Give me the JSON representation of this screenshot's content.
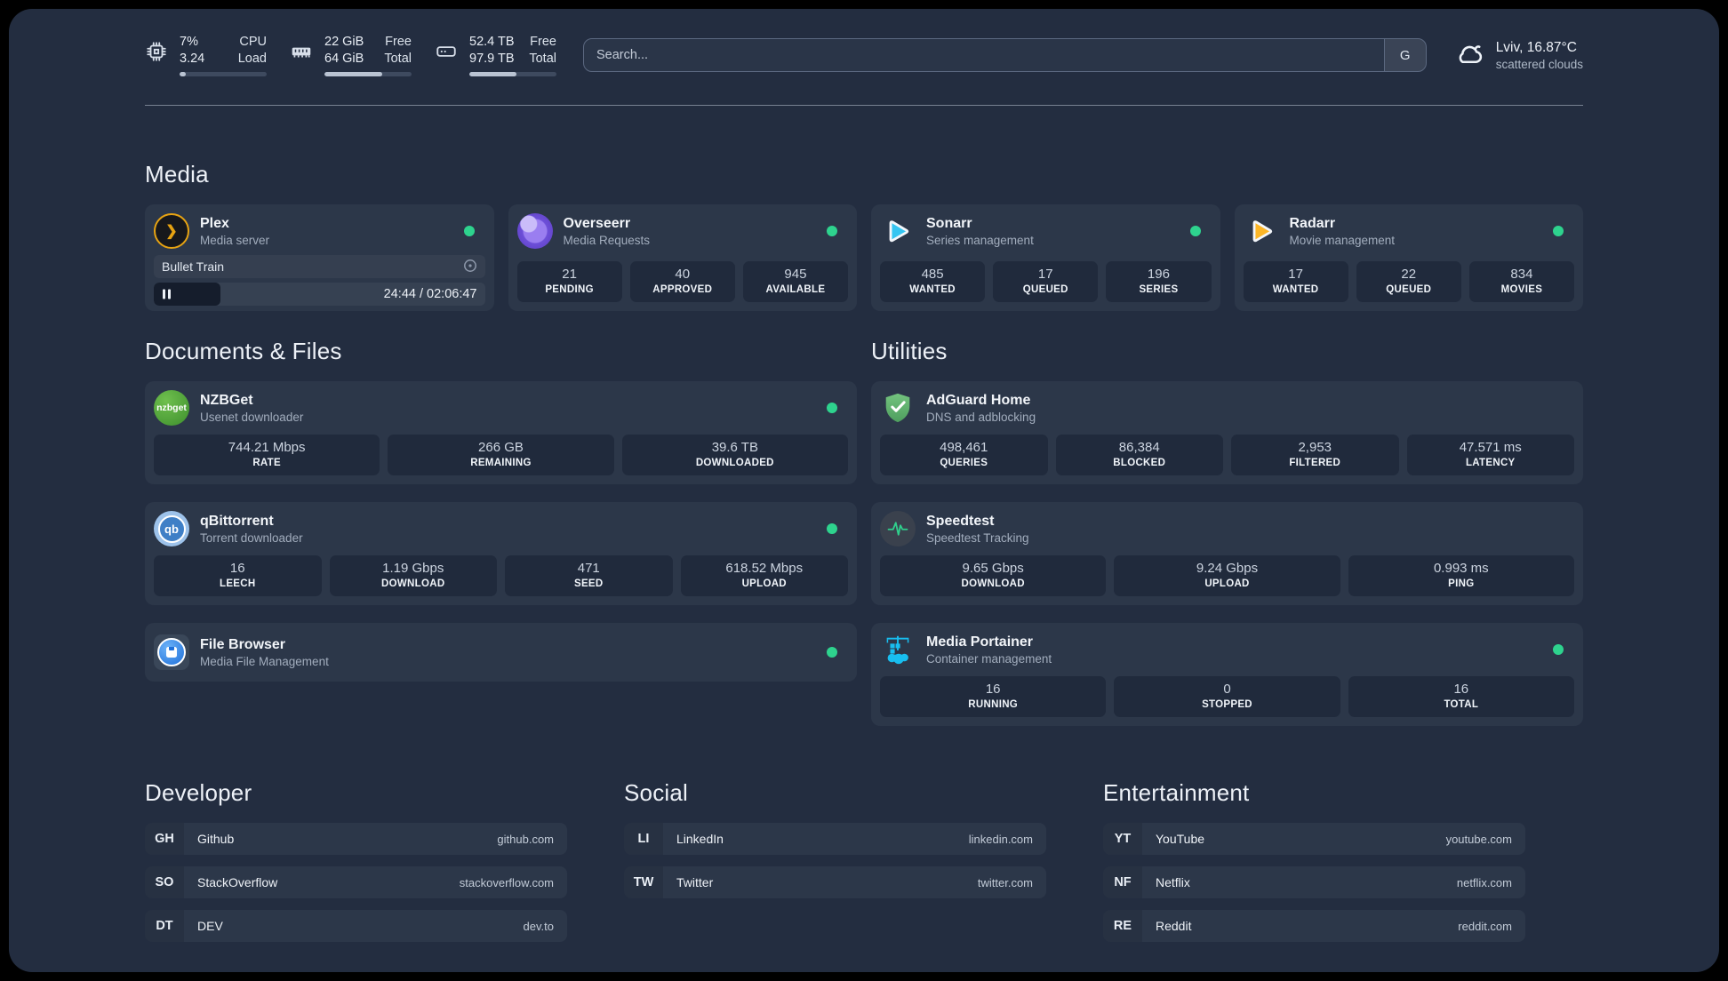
{
  "system": {
    "cpu": {
      "value_top": "7%",
      "value_bottom": "3.24",
      "label_top": "CPU",
      "label_bottom": "Load",
      "bar_percent": 7
    },
    "memory": {
      "value_top": "22 GiB",
      "value_bottom": "64 GiB",
      "label_top": "Free",
      "label_bottom": "Total",
      "bar_percent": 66
    },
    "disk": {
      "value_top": "52.4 TB",
      "value_bottom": "97.9 TB",
      "label_top": "Free",
      "label_bottom": "Total",
      "bar_percent": 54
    }
  },
  "search": {
    "placeholder": "Search...",
    "provider_label": "G"
  },
  "weather": {
    "location_temp": "Lviv, 16.87°C",
    "condition": "scattered clouds"
  },
  "icons": {
    "nzbget_text": "nzbget",
    "qbittorrent_text": "qb"
  },
  "colors": {
    "panel_bg": "#232d40",
    "card_bg": "#2c3749",
    "stat_bg": "#202a3c",
    "status_online": "#2ed38e",
    "plex": "#e7a312",
    "overseerr": "#8b5cf6",
    "sonarr": "#35c5f1",
    "radarr": "#fcb626",
    "nzbget": "#4aa236",
    "qbittorrent": "#3f7fc6",
    "filebrowser": "#1e6fd9",
    "adguard": "#5fae6d",
    "speedtest_pulse": "#2fd08c",
    "portainer": "#18bef0"
  },
  "sections": {
    "media": {
      "title": "Media",
      "services": [
        {
          "name": "Plex",
          "desc": "Media server",
          "player": {
            "title": "Bullet Train",
            "time": "24:44 / 02:06:47",
            "progress_percent": 20
          }
        },
        {
          "name": "Overseerr",
          "desc": "Media Requests",
          "stats": [
            {
              "value": "21",
              "label": "PENDING"
            },
            {
              "value": "40",
              "label": "APPROVED"
            },
            {
              "value": "945",
              "label": "AVAILABLE"
            }
          ]
        },
        {
          "name": "Sonarr",
          "desc": "Series management",
          "stats": [
            {
              "value": "485",
              "label": "WANTED"
            },
            {
              "value": "17",
              "label": "QUEUED"
            },
            {
              "value": "196",
              "label": "SERIES"
            }
          ]
        },
        {
          "name": "Radarr",
          "desc": "Movie management",
          "stats": [
            {
              "value": "17",
              "label": "WANTED"
            },
            {
              "value": "22",
              "label": "QUEUED"
            },
            {
              "value": "834",
              "label": "MOVIES"
            }
          ]
        }
      ]
    },
    "documents": {
      "title": "Documents & Files",
      "services": [
        {
          "name": "NZBGet",
          "desc": "Usenet downloader",
          "stats": [
            {
              "value": "744.21 Mbps",
              "label": "RATE"
            },
            {
              "value": "266 GB",
              "label": "REMAINING"
            },
            {
              "value": "39.6 TB",
              "label": "DOWNLOADED"
            }
          ]
        },
        {
          "name": "qBittorrent",
          "desc": "Torrent downloader",
          "stats": [
            {
              "value": "16",
              "label": "LEECH"
            },
            {
              "value": "1.19 Gbps",
              "label": "DOWNLOAD"
            },
            {
              "value": "471",
              "label": "SEED"
            },
            {
              "value": "618.52 Mbps",
              "label": "UPLOAD"
            }
          ]
        },
        {
          "name": "File Browser",
          "desc": "Media File Management",
          "stats": []
        }
      ]
    },
    "utilities": {
      "title": "Utilities",
      "services": [
        {
          "name": "AdGuard Home",
          "desc": "DNS and adblocking",
          "stats": [
            {
              "value": "498,461",
              "label": "QUERIES"
            },
            {
              "value": "86,384",
              "label": "BLOCKED"
            },
            {
              "value": "2,953",
              "label": "FILTERED"
            },
            {
              "value": "47.571 ms",
              "label": "LATENCY"
            }
          ]
        },
        {
          "name": "Speedtest",
          "desc": "Speedtest Tracking",
          "stats": [
            {
              "value": "9.65 Gbps",
              "label": "DOWNLOAD"
            },
            {
              "value": "9.24 Gbps",
              "label": "UPLOAD"
            },
            {
              "value": "0.993 ms",
              "label": "PING"
            }
          ]
        },
        {
          "name": "Media Portainer",
          "desc": "Container management",
          "stats": [
            {
              "value": "16",
              "label": "RUNNING"
            },
            {
              "value": "0",
              "label": "STOPPED"
            },
            {
              "value": "16",
              "label": "TOTAL"
            }
          ]
        }
      ]
    }
  },
  "bookmarks": [
    {
      "title": "Developer",
      "items": [
        {
          "abbr": "GH",
          "name": "Github",
          "url": "github.com"
        },
        {
          "abbr": "SO",
          "name": "StackOverflow",
          "url": "stackoverflow.com"
        },
        {
          "abbr": "DT",
          "name": "DEV",
          "url": "dev.to"
        }
      ]
    },
    {
      "title": "Social",
      "items": [
        {
          "abbr": "LI",
          "name": "LinkedIn",
          "url": "linkedin.com"
        },
        {
          "abbr": "TW",
          "name": "Twitter",
          "url": "twitter.com"
        }
      ]
    },
    {
      "title": "Entertainment",
      "items": [
        {
          "abbr": "YT",
          "name": "YouTube",
          "url": "youtube.com"
        },
        {
          "abbr": "NF",
          "name": "Netflix",
          "url": "netflix.com"
        },
        {
          "abbr": "RE",
          "name": "Reddit",
          "url": "reddit.com"
        }
      ]
    }
  ]
}
